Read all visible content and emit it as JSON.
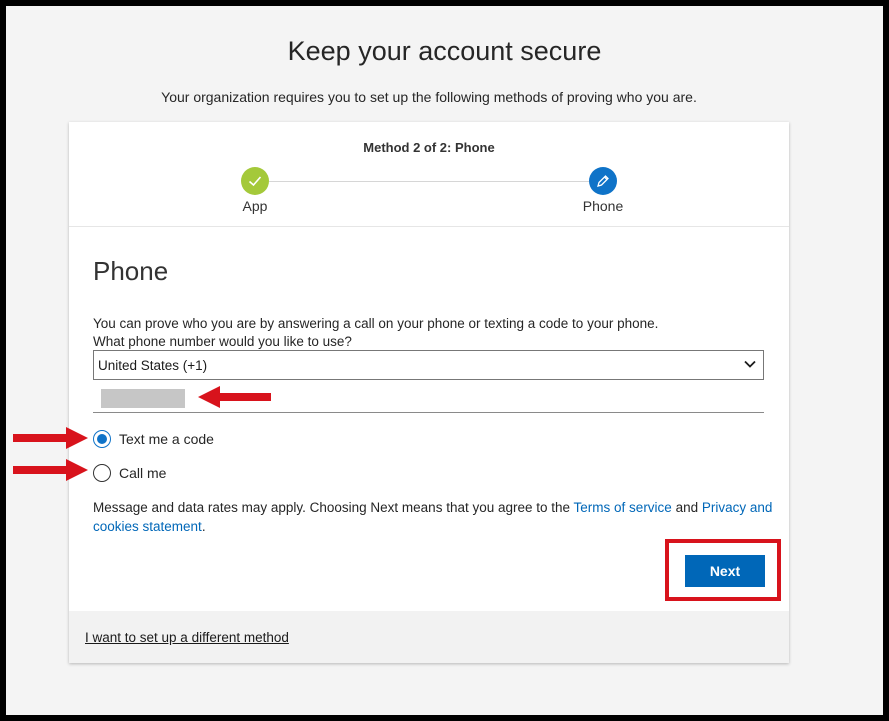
{
  "page": {
    "title": "Keep your account secure",
    "subtitle": "Your organization requires you to set up the following methods of proving who you are."
  },
  "progress": {
    "method_label": "Method 2 of 2: Phone",
    "steps": [
      {
        "label": "App",
        "state": "completed",
        "icon": "check-icon",
        "color": "#a4c93a"
      },
      {
        "label": "Phone",
        "state": "current",
        "icon": "pencil-icon",
        "color": "#0f73c8"
      }
    ]
  },
  "form": {
    "section_title": "Phone",
    "description_line1": "You can prove who you are by answering a call on your phone or texting a code to your phone.",
    "description_line2": "What phone number would you like to use?",
    "country_select": {
      "value": "United States (+1)"
    },
    "phone_number": {
      "redacted": true
    },
    "options": [
      {
        "label": "Text me a code",
        "selected": true
      },
      {
        "label": "Call me",
        "selected": false
      }
    ],
    "legal_prefix": "Message and data rates may apply. Choosing Next means that you agree to the ",
    "terms_link": "Terms of service",
    "legal_and": " and ",
    "privacy_link": "Privacy and cookies statement",
    "legal_suffix": ".",
    "next_label": "Next"
  },
  "footer": {
    "link_label": "I want to set up a different method"
  },
  "colors": {
    "accent": "#0067b8",
    "success": "#a4c93a",
    "annotation_red": "#d8131c"
  }
}
